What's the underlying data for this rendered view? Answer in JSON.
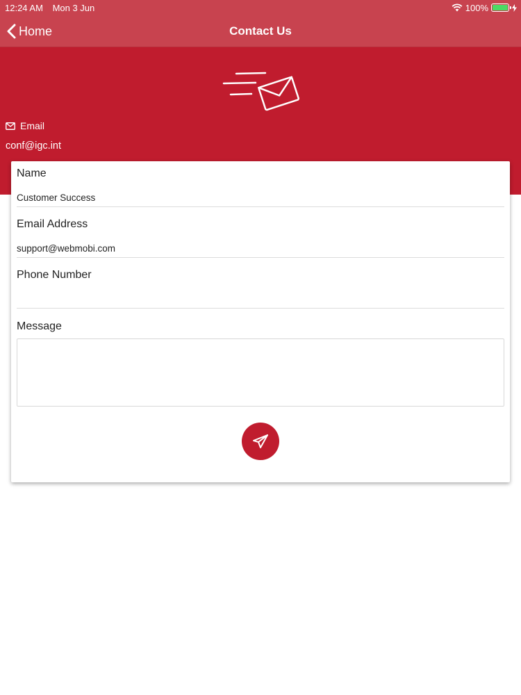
{
  "status_bar": {
    "time": "12:24 AM",
    "date": "Mon 3 Jun",
    "battery": "100%",
    "battery_color": "#4cd964"
  },
  "nav": {
    "back_label": "Home",
    "title": "Contact Us",
    "color": "#c8434f"
  },
  "header": {
    "icon": "flying-envelope-icon",
    "email_label": "Email",
    "email_value": "conf@igc.int",
    "color": "#c01c2e"
  },
  "form": {
    "name_label": "Name",
    "name_value": "Customer Success",
    "email_label": "Email Address",
    "email_value": "support@webmobi.com",
    "phone_label": "Phone Number",
    "phone_value": "",
    "message_label": "Message",
    "message_value": "",
    "send_icon": "paper-plane-icon"
  }
}
